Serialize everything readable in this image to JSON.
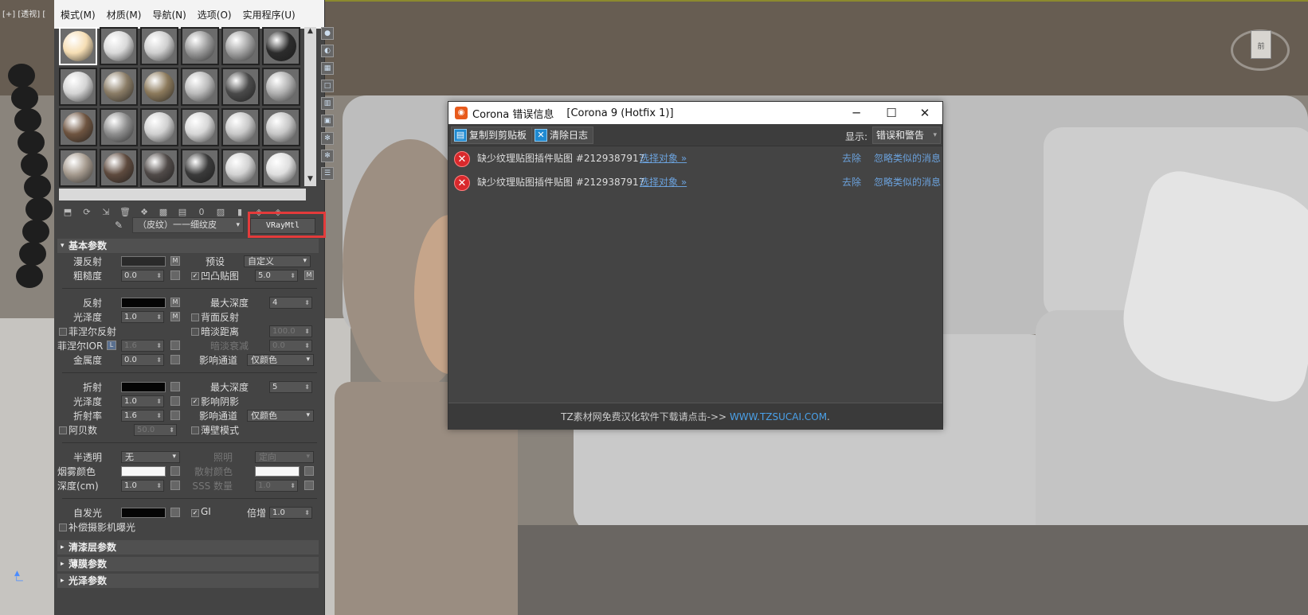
{
  "viewport": {
    "label": "[+] [透视] [",
    "navcube_label": "前"
  },
  "material_editor": {
    "menu": [
      "模式(M)",
      "材质(M)",
      "导航(N)",
      "选项(O)",
      "实用程序(U)"
    ],
    "material_name": "（皮纹）一一细纹皮",
    "material_type": "VRayMtl",
    "rollouts": {
      "basic": "基本参数",
      "coat": "清漆层参数",
      "sheen": "薄膜参数",
      "gloss": "光泽参数"
    },
    "params": {
      "diffuse": "漫反射",
      "preset": "预设",
      "preset_value": "自定义",
      "roughness": "粗糙度",
      "roughness_value": "0.0",
      "bump": "凹凸贴图",
      "bump_value": "5.0",
      "reflect": "反射",
      "max_depth": "最大深度",
      "max_depth_value": "4",
      "gloss": "光泽度",
      "gloss_value": "1.0",
      "backside": "背面反射",
      "fresnel": "菲涅尔反射",
      "dim_dist": "暗淡距离",
      "dim_dist_value": "100.0",
      "fresnel_ior": "菲涅尔IOR",
      "fresnel_ior_value": "1.6",
      "dim_falloff": "暗淡衰减",
      "dim_falloff_value": "0.0",
      "metal": "金属度",
      "metal_value": "0.0",
      "affect_ch": "影响通道",
      "affect_ch_value": "仅颜色",
      "refract": "折射",
      "ref_max_depth": "最大深度",
      "ref_max_depth_value": "5",
      "ref_gloss": "光泽度",
      "ref_gloss_value": "1.0",
      "affect_shadows": "影响阴影",
      "ior": "折射率",
      "ior_value": "1.6",
      "ref_affect_ch": "影响通道",
      "ref_affect_ch_value": "仅颜色",
      "abbe": "阿贝数",
      "abbe_value": "50.0",
      "thin_walled": "薄壁模式",
      "translucency": "半透明",
      "translucency_value": "无",
      "illum": "照明",
      "illum_value": "定向",
      "fog_color": "烟雾颜色",
      "scatter_color": "散射颜色",
      "depth": "深度(cm)",
      "depth_value": "1.0",
      "sss": "SSS 数量",
      "sss_value": "1.0",
      "self_illum": "自发光",
      "gi": "GI",
      "mult": "倍增",
      "mult_value": "1.0",
      "comp_exposure": "补偿摄影机曝光"
    },
    "sphere_colors": [
      "#f6deb4",
      "#d9d9d9",
      "#cfcfcf",
      "#9a9a9a",
      "#a3a3a3",
      "#2c2c2c",
      "#d4d4d4",
      "#8a7c66",
      "#8c7a5c",
      "#bbbbbb",
      "#4a4a4a",
      "#b0b0b0",
      "#6e5440",
      "#8e8e8e",
      "#d0d0d0",
      "#d6d6d6",
      "#c8c8c8",
      "#c6c6c6",
      "#a59a8e",
      "#5e4a3e",
      "#504a48",
      "#3a3a3a",
      "#d2d2d2",
      "#dedede"
    ]
  },
  "dialog": {
    "title": "Corona 错误信息",
    "version": "[Corona 9 (Hotfix 1)]",
    "copy_btn": "复制到剪贴板",
    "clear_btn": "清除日志",
    "show_label": "显示:",
    "show_value": "错误和警告",
    "messages": [
      {
        "text": "缺少纹理贴图插件贴图 #2129387917",
        "select": "选择对象 »",
        "remove": "去除",
        "ignore": "忽略类似的消息"
      },
      {
        "text": "缺少纹理贴图插件贴图 #2129387917",
        "select": "选择对象 »",
        "remove": "去除",
        "ignore": "忽略类似的消息"
      }
    ],
    "footer": "TZ素材网免费汉化软件下载请点击->> ",
    "footer_url": "WWW.TZSUCAI.COM",
    "footer_end": "."
  }
}
